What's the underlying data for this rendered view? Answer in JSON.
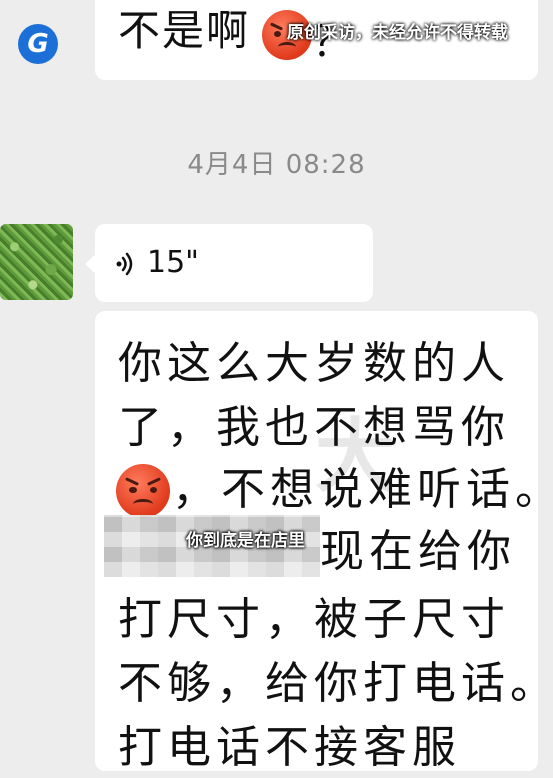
{
  "top_message": {
    "text": "不是啊",
    "emoji": "angry-face",
    "suffix": "？"
  },
  "overlay": {
    "logo_glyph": "G",
    "copyright_note": "原创采访，未经允许不得转载",
    "subtitle": "你到底是在店里"
  },
  "timestamp": "4月4日 08:28",
  "voice_message": {
    "duration": "15\"",
    "icon": "voice-wave-icon"
  },
  "text_message": {
    "lines": [
      "你这么大岁数的人",
      "了，我也不想骂你",
      "，不想说难听话。",
      "现在给你",
      "打尺寸，被子尺寸",
      "不够，给你打电话。",
      "打电话不接客服"
    ],
    "emoji": "angry-face"
  },
  "ghost_watermark": "大"
}
